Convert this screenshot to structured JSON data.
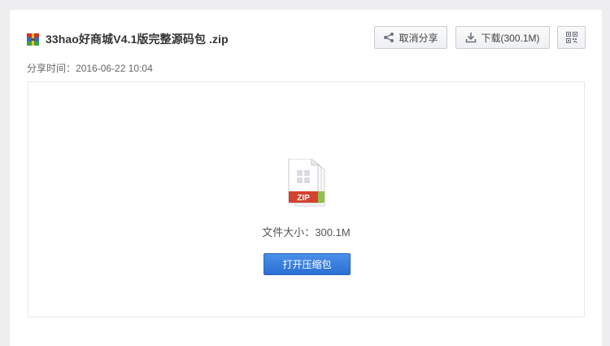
{
  "file": {
    "title": "33hao好商城V4.1版完整源码包 .zip",
    "share_time_label": "分享时间：",
    "share_time": "2016-06-22 10:04",
    "size_label": "文件大小：",
    "size": "300.1M",
    "type_badge": "ZIP"
  },
  "actions": {
    "cancel_share": "取消分享",
    "download": "下载(300.1M)",
    "open_archive": "打开压缩包"
  },
  "icons": {
    "title_icon": "zip-file-icon",
    "share": "share-icon",
    "download": "download-icon",
    "qrcode": "qrcode-icon",
    "preview": "zip-file-large-icon"
  },
  "colors": {
    "primary_button": "#2b6fd2",
    "zip_badge": "#d2432f",
    "page_bg": "#eeeef0"
  }
}
